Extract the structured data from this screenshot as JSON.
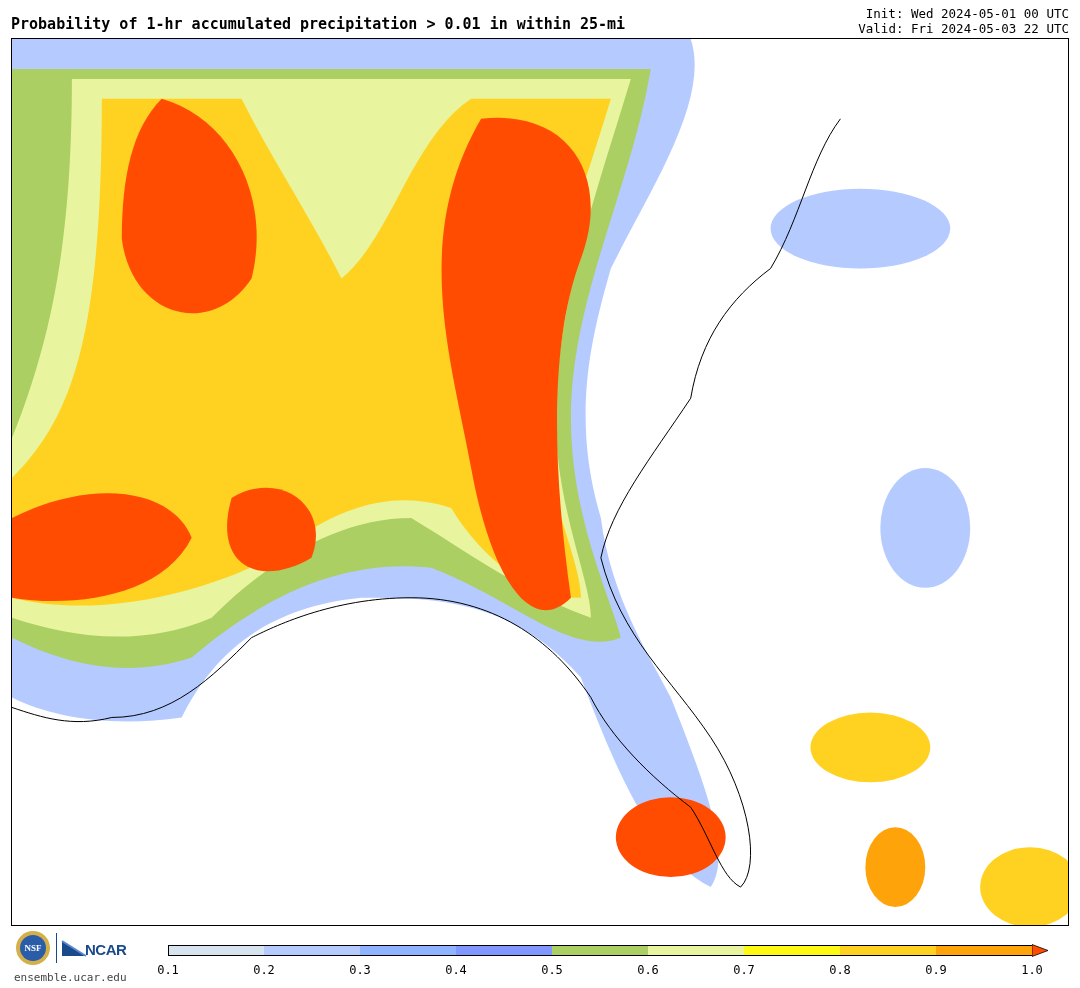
{
  "title": "Probability of 1-hr accumulated precipitation > 0.01 in within 25-mi",
  "init": "Init: Wed 2024-05-01 00 UTC",
  "valid": "Valid: Fri 2024-05-03 22 UTC",
  "footer": {
    "seal_text": "NSF",
    "org": "NCAR",
    "url": "ensemble.ucar.edu"
  },
  "colorbar": {
    "bins": [
      {
        "color": "#d7e3ee"
      },
      {
        "color": "#b5caff"
      },
      {
        "color": "#8fb3ff"
      },
      {
        "color": "#7f97ff"
      },
      {
        "color": "#abcf63"
      },
      {
        "color": "#e8f59e"
      },
      {
        "color": "#fffa14"
      },
      {
        "color": "#ffd121"
      },
      {
        "color": "#ffa30a"
      },
      {
        "kind": "arrow",
        "color": "#ff4c00"
      }
    ],
    "ticks": [
      "0.1",
      "0.2",
      "0.3",
      "0.4",
      "0.5",
      "0.6",
      "0.7",
      "0.8",
      "0.9",
      "1.0"
    ]
  }
}
